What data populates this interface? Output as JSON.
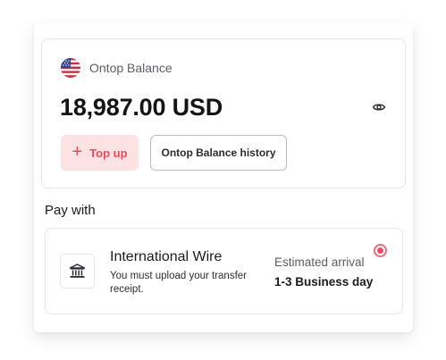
{
  "balance": {
    "label": "Ontop Balance",
    "amount": "18,987.00 USD",
    "flag_icon": "us-flag-icon",
    "visibility_icon": "eye-icon"
  },
  "actions": {
    "topup_label": "Top up",
    "history_label": "Ontop Balance history"
  },
  "payment": {
    "section_title": "Pay with",
    "methods": [
      {
        "icon": "bank-icon",
        "title": "International Wire",
        "description": "You must upload your transfer receipt.",
        "arrival_label": "Estimated arrival",
        "arrival_value": "1-3 Business day",
        "selected": true
      }
    ]
  },
  "colors": {
    "accent": "#ee4a5c",
    "accent_soft": "#fde2e4",
    "border": "#e6e6ea",
    "text": "#1b1b1f",
    "muted": "#5d5d66"
  }
}
